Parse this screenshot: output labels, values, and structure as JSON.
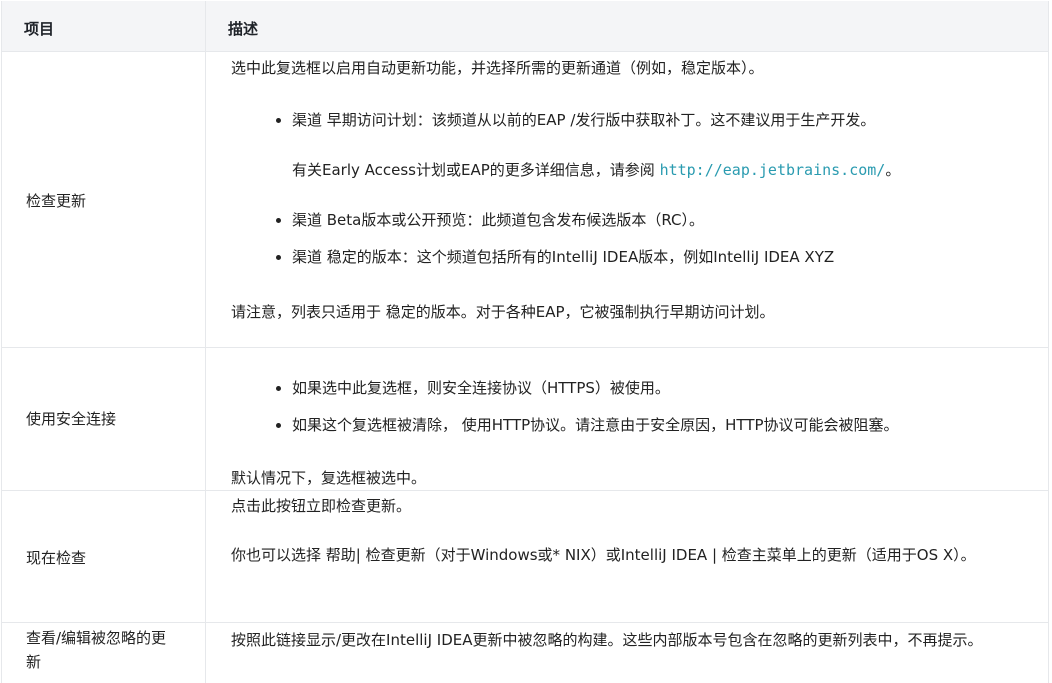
{
  "header": {
    "col_item": "项目",
    "col_desc": "描述"
  },
  "rows": [
    {
      "item": "检查更新",
      "intro": "选中此复选框以启用自动更新功能，并选择所需的更新通道（例如，稳定版本）。",
      "b1": "渠道 早期访问计划：该频道从以前的EAP /发行版中获取补丁。这不建议用于生产开发。",
      "sub_pre": "有关Early Access计划或EAP的更多详细信息，请参阅 ",
      "sub_link": "http://eap.jetbrains.com/",
      "sub_post": "。",
      "b2": "渠道 Beta版本或公开预览：此频道包含发布候选版本（RC）。",
      "b3": "渠道 稳定的版本：这个频道包括所有的IntelliJ IDEA版本，例如IntelliJ IDEA XYZ",
      "note": "请注意，列表只适用于 稳定的版本。对于各种EAP，它被强制执行早期访问计划。"
    },
    {
      "item": "使用安全连接",
      "b1": "如果选中此复选框，则安全连接协议（HTTPS）被使用。",
      "b2": "如果这个复选框被清除， 使用HTTP协议。请注意由于安全原因，HTTP协议可能会被阻塞。",
      "note": "默认情况下，复选框被选中。"
    },
    {
      "item": "现在检查",
      "line1": "点击此按钮立即检查更新。",
      "line2": "你也可以选择 帮助| 检查更新（对于Windows或* NIX）或IntelliJ IDEA | 检查主菜单上的更新（适用于OS X）。"
    },
    {
      "item": "查看/编辑被忽略的更新",
      "line1": "按照此链接显示/更改在IntelliJ IDEA更新中被忽略的构建。这些内部版本号包含在忽略的更新列表中，不再提示。"
    }
  ]
}
